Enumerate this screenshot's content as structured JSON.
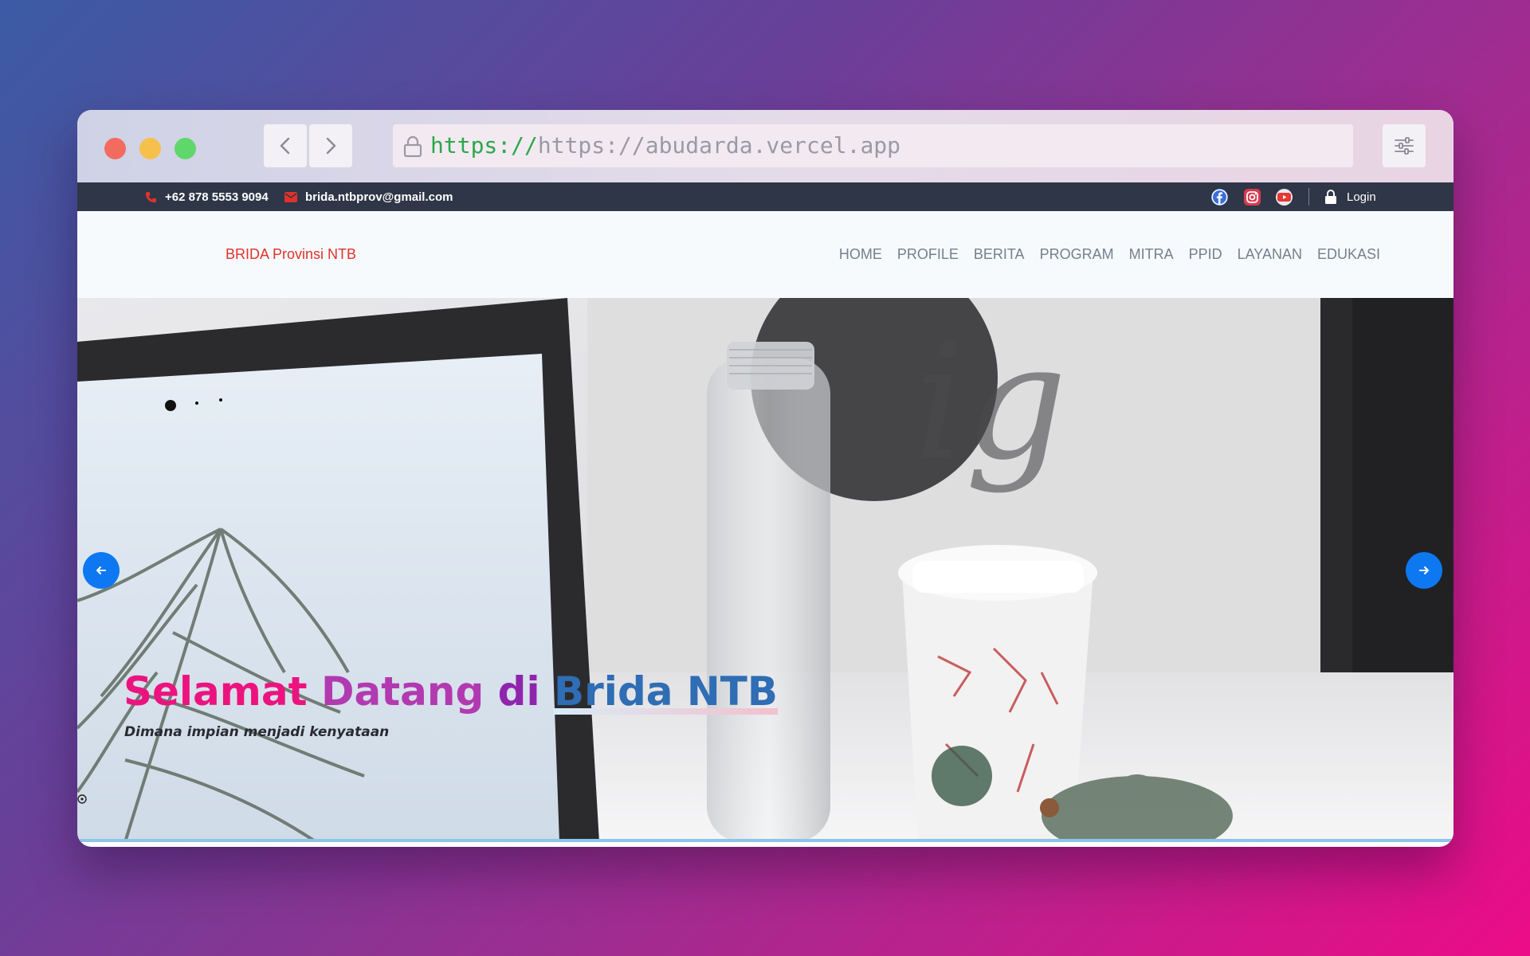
{
  "browser": {
    "url_scheme": "https://",
    "url_rest": "https://abudarda.vercel.app",
    "icons": [
      "back-icon",
      "forward-icon",
      "lock-icon",
      "settings-sliders-icon"
    ]
  },
  "topbar": {
    "phone": "+62 878 5553 9094",
    "email": "brida.ntbprov@gmail.com",
    "login": "Login",
    "social_icons": [
      "facebook-icon",
      "instagram-icon",
      "youtube-icon"
    ]
  },
  "nav": {
    "brand": "BRIDA Provinsi NTB",
    "items": [
      "HOME",
      "PROFILE",
      "BERITA",
      "PROGRAM",
      "MITRA",
      "PPID",
      "LAYANAN",
      "EDUKASI"
    ]
  },
  "hero": {
    "headline_words": [
      "Selamat",
      "Datang",
      "di",
      "Brida",
      "NTB"
    ],
    "tagline": "Dimana impian menjadi kenyataan"
  },
  "colors": {
    "accent_red": "#e0322c",
    "topbar_bg": "#2e3647",
    "slider_button": "#0d78f2",
    "headline_pink": "#ec137f",
    "headline_blue": "#2f6db4"
  }
}
